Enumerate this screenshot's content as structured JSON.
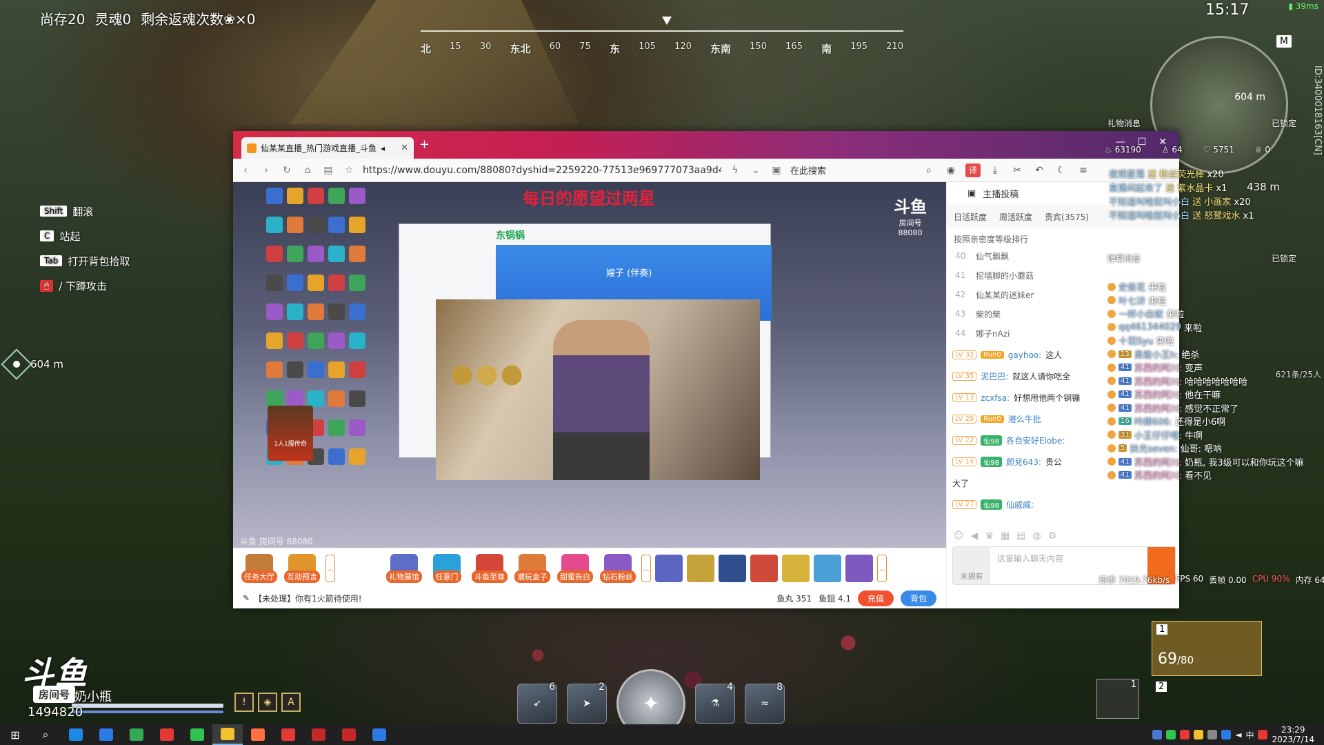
{
  "hud": {
    "survive": "尚存20",
    "soul": "灵魂0",
    "revive": "剩余返魂次数",
    "revive_count": "×0",
    "clock": "15:17",
    "netstat": "39ms",
    "compass": [
      "北",
      "15",
      "30",
      "东北",
      "60",
      "75",
      "东",
      "105",
      "120",
      "东南",
      "150",
      "165",
      "南",
      "195",
      "210"
    ],
    "compass_major": [
      "北",
      "东北",
      "东",
      "东南",
      "南"
    ],
    "map_key": "M",
    "map_dist": "604 m",
    "vertical_id": "ID:3400018163[CN]",
    "dist_secondary": "438 m",
    "keyhints": [
      {
        "key": "Shift",
        "label": "翻滚"
      },
      {
        "key": "C",
        "label": "站起"
      },
      {
        "key": "Tab",
        "label": "打开背包拾取"
      },
      {
        "key": "",
        "label": "/  下蹲攻击"
      }
    ],
    "waypoint_dist": "604 m",
    "player_name": "奶小瓶",
    "player_score": "1494820",
    "douyu_logo": "斗鱼",
    "douyu_sub": "房间号",
    "skills": [
      {
        "name": "skill-1",
        "count": "6"
      },
      {
        "name": "skill-2",
        "count": "2"
      },
      {
        "name": "skill-4",
        "count": "4"
      },
      {
        "name": "skill-5",
        "count": "8"
      }
    ],
    "weapon_slot1": "1",
    "weapon_ammo": "69",
    "weapon_ammo_max": "/80",
    "weapon_slot2": "2",
    "backpack_count": "1"
  },
  "browser": {
    "tab_title": "仙某某直播_热门游戏直播_斗鱼",
    "url": "https://www.douyu.com/88080?dyshid=2259220-77513e969777073aa9d415",
    "search_placeholder": "在此搜索",
    "stream": {
      "title": "每日的愿望过两星",
      "watermark": "斗鱼",
      "room": "房间号",
      "room_no": "88080",
      "inner_green": "东锅锅",
      "inner_center": "嫂子 (伴奏)",
      "footer_tag": "斗鱼 房间号 88080",
      "promo": "1人1服传奇"
    },
    "gifts": [
      {
        "label": "任务大厅",
        "color": "#c27b38"
      },
      {
        "label": "互动预言",
        "color": "#e0952a"
      },
      {
        "label": "礼物展馆",
        "color": "#5c6ec7"
      },
      {
        "label": "任意门",
        "color": "#2aa1d9"
      },
      {
        "label": "斗鱼至尊",
        "color": "#d4463a"
      },
      {
        "label": "潮玩盒子",
        "color": "#e07a3a"
      },
      {
        "label": "甜蜜告白",
        "color": "#e44a8c"
      },
      {
        "label": "钻石粉丝",
        "color": "#8a5ac7"
      }
    ],
    "gift_items": [
      "#5a66c0",
      "#c6a23a",
      "#2f4f8f",
      "#d04a3a",
      "#d6b23a",
      "#4a9fd6",
      "#7d5ac0"
    ],
    "notice": "【未处理】你有1火箭待使用!",
    "yuwan": "鱼丸 351",
    "yuchi": "鱼翅 4.1",
    "recharge": "充值",
    "backpack": "背包",
    "side": {
      "head_label": "主播投稿",
      "tabs": [
        "日活跃度",
        "周活跃度",
        "贵宾(3575)"
      ],
      "rank_title": "按照亲密度等级排行",
      "ranks": [
        {
          "n": "40",
          "name": "仙气飘飘"
        },
        {
          "n": "41",
          "name": "挖墙脚的小蘑菇"
        },
        {
          "n": "42",
          "name": "仙某某的迷妹er"
        },
        {
          "n": "43",
          "name": "柴的柴"
        },
        {
          "n": "44",
          "name": "娜子nAzi"
        }
      ],
      "chat": [
        {
          "lv": "LV 32",
          "badge": "Run0",
          "nick": "gayhoo:",
          "text": "这人"
        },
        {
          "lv": "LV 35",
          "badge": "",
          "nick": "泥巴巴:",
          "text": "就这人请你吃全"
        },
        {
          "lv": "LV 13",
          "badge": "",
          "nick": "zcxfsa:",
          "text": "好想甩他两个钢镚"
        },
        {
          "lv": "LV 29",
          "badge": "Run0",
          "nick": "港么牛批",
          "text": ""
        },
        {
          "lv": "LV 22",
          "badge": "仙98",
          "nick": "各自安好Elobe:",
          "text": ""
        },
        {
          "lv": "LV 14",
          "badge": "仙98",
          "nick": "颜兒643:",
          "text": "贵公"
        },
        {
          "lv": "",
          "badge": "",
          "nick": "",
          "text": "大了"
        },
        {
          "lv": "LV 27",
          "badge": "仙98",
          "nick": "仙戚戚:",
          "text": ""
        }
      ],
      "input_placeholder": "这里输入聊天内容",
      "no_avatar": "未拥有"
    }
  },
  "overlay": {
    "gift_title": "礼物消息",
    "locked": "已锁定",
    "stats": [
      "63190",
      "64",
      "5751",
      "0"
    ],
    "gift_lines": [
      {
        "user": "夜观星落",
        "act": "送 粉丝荧光棒",
        "qty": "x20"
      },
      {
        "user": "直播间起来了",
        "act": "送 紫水晶卡",
        "qty": "x1"
      },
      {
        "user": "不知道叫啥就叫小白",
        "act": "送 小画家",
        "qty": "x20"
      },
      {
        "user": "不知道叫啥就叫小白",
        "act": "送 怒鹭戏水",
        "qty": "x1"
      }
    ],
    "dm_title": "弹幕消息",
    "dm_locked": "已锁定",
    "dm_count": "621条/25人",
    "dm_lines": [
      {
        "badge": "",
        "nick": "史俊花",
        "text": "来啦"
      },
      {
        "badge": "",
        "nick": "叶七浒",
        "text": "来啦"
      },
      {
        "badge": "",
        "nick": "一样小白蚁",
        "text": "来啦"
      },
      {
        "badge": "",
        "nick": "qq461344029",
        "text": "来啦"
      },
      {
        "badge": "",
        "nick": "十羽Syu",
        "text": "来啦"
      },
      {
        "badge": "13",
        "nick": "勇敢小王h:",
        "text": "绝杀"
      },
      {
        "badge": "41",
        "nick": "苏西的阿川:",
        "text": "变声"
      },
      {
        "badge": "41",
        "nick": "苏西的阿川:",
        "text": "哈哈哈哈哈哈哈"
      },
      {
        "badge": "41",
        "nick": "苏西的阿川:",
        "text": "他在干嘛"
      },
      {
        "badge": "41",
        "nick": "苏西的阿川:",
        "text": "感觉不正常了"
      },
      {
        "badge": "16",
        "nick": "吟卿606:",
        "text": "还得是小6啊"
      },
      {
        "badge": "31",
        "nick": "小王仔仔哩:",
        "text": "牛啊"
      },
      {
        "badge": "5",
        "nick": "扶光seven:",
        "text": "仙哥: 嗯呐"
      },
      {
        "badge": "41",
        "nick": "苏西的阿川:",
        "text": "奶瓶, 我3级可以和你玩这个嘛"
      },
      {
        "badge": "41",
        "nick": "苏西的阿川:",
        "text": "看不见"
      }
    ],
    "perf": {
      "bitrate": "码率 7019.76kb/s",
      "fps": "FPS 60",
      "drop": "丢帧 0.00",
      "cpu": "CPU 90%",
      "mem": "内存 64%"
    }
  },
  "taskbar": {
    "time": "23:29",
    "date": "2023/7/14",
    "ime": "中",
    "apps": [
      "#1e88e5",
      "#2a7be4",
      "#34a853",
      "#e53935",
      "#2fc450",
      "#f2c12e",
      "#ff7043",
      "#e53935",
      "#c62828",
      "#c62828",
      "#2a7be4"
    ]
  }
}
